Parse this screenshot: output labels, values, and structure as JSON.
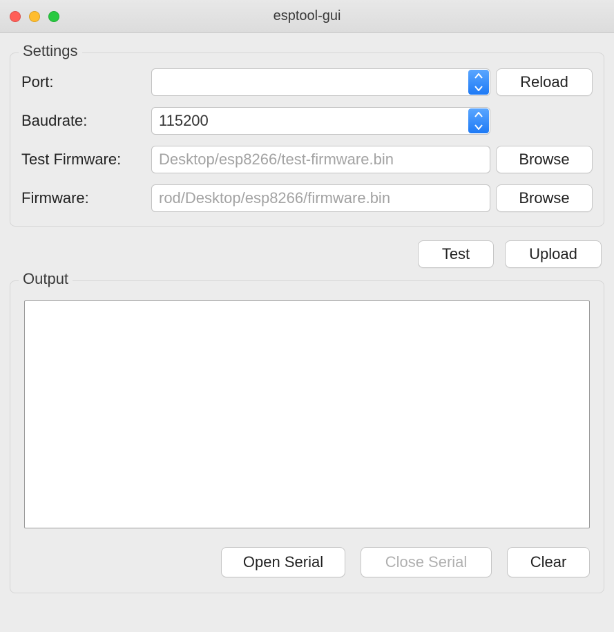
{
  "window": {
    "title": "esptool-gui"
  },
  "settings": {
    "legend": "Settings",
    "port_label": "Port:",
    "port_value": "",
    "reload_label": "Reload",
    "baud_label": "Baudrate:",
    "baud_value": "115200",
    "test_fw_label": "Test Firmware:",
    "test_fw_value": "Desktop/esp8266/test-firmware.bin",
    "test_fw_browse": "Browse",
    "fw_label": "Firmware:",
    "fw_value": "rod/Desktop/esp8266/firmware.bin",
    "fw_browse": "Browse"
  },
  "actions": {
    "test_label": "Test",
    "upload_label": "Upload"
  },
  "output": {
    "legend": "Output",
    "content": "",
    "open_serial": "Open Serial",
    "close_serial": "Close Serial",
    "clear": "Clear"
  }
}
